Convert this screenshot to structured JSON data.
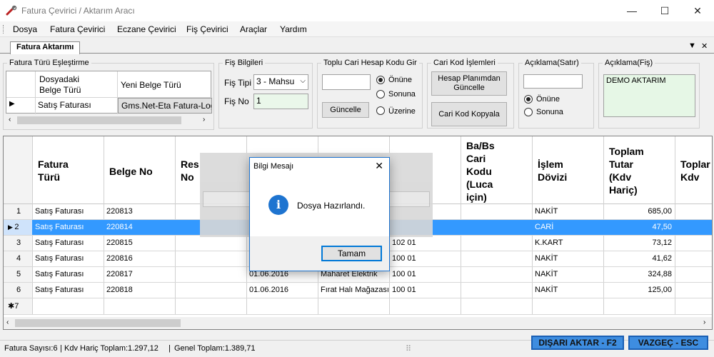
{
  "window": {
    "title": "Fatura Çevirici / Aktarım Aracı"
  },
  "menu": [
    "Dosya",
    "Fatura Çevirici",
    "Eczane Çevirici",
    "Fiş Çevirici",
    "Araçlar",
    "Yardım"
  ],
  "tab": {
    "label": "Fatura Aktarımı"
  },
  "mapping": {
    "title": "Fatura Türü Eşleştirme",
    "col1": "Dosyadaki\nBelge Türü",
    "col2": "Yeni Belge Türü",
    "row_source": "Satış Faturası",
    "row_target": "Gms.Net-Eta Fatura-Log"
  },
  "fis": {
    "title": "Fiş Bilgileri",
    "tip_label": "Fiş Tipi",
    "tip_value": "3 - Mahsu",
    "no_label": "Fiş No",
    "no_value": "1"
  },
  "toplu": {
    "title": "Toplu Cari Hesap Kodu Gir",
    "input_value": "",
    "button": "Güncelle",
    "options": [
      "Önüne",
      "Sonuna",
      "Üzerine"
    ],
    "selected": 0
  },
  "cari": {
    "title": "Cari Kod İşlemleri",
    "btn_update": "Hesap Planımdan\nGüncelle",
    "btn_copy": "Cari Kod Kopyala"
  },
  "aciklama_satir": {
    "title": "Açıklama(Satır)",
    "input_value": "",
    "options": [
      "Önüne",
      "Sonuna"
    ],
    "selected": 0
  },
  "aciklama_fis": {
    "title": "Açıklama(Fiş)",
    "value": "DEMO AKTARIM"
  },
  "grid": {
    "headers": [
      "Fatura\nTürü",
      "Belge No",
      "Res\nNo",
      "",
      "",
      "Ba/Bs\nCari\nKodu\n(Luca\niçin)",
      "İşlem\nDövizi",
      "Toplam\nTutar\n(Kdv\nHariç)",
      "Toplar\nKdv"
    ],
    "rows": [
      {
        "num": "1",
        "tur": "Satış Faturası",
        "belge": "220813",
        "tarih": "",
        "unvan": "",
        "kod": "",
        "doviz": "NAKİT",
        "tutar": "685,00"
      },
      {
        "num": "2",
        "tur": "Satış Faturası",
        "belge": "220814",
        "tarih": "",
        "unvan": "",
        "kod": "",
        "doviz": "CARİ",
        "tutar": "47,50"
      },
      {
        "num": "3",
        "tur": "Satış Faturası",
        "belge": "220815",
        "tarih": "",
        "unvan": "",
        "kod": "102 01",
        "doviz": "K.KART",
        "tutar": "73,12"
      },
      {
        "num": "4",
        "tur": "Satış Faturası",
        "belge": "220816",
        "tarih": "",
        "unvan": "",
        "kod": "100 01",
        "doviz": "NAKİT",
        "tutar": "41,62"
      },
      {
        "num": "5",
        "tur": "Satış Faturası",
        "belge": "220817",
        "tarih": "01.06.2016",
        "unvan": "Maharet Elektrik",
        "kod": "100 01",
        "doviz": "NAKİT",
        "tutar": "324,88"
      },
      {
        "num": "6",
        "tur": "Satış Faturası",
        "belge": "220818",
        "tarih": "01.06.2016",
        "unvan": "Fırat Halı Mağazası",
        "kod": "100 01",
        "doviz": "NAKİT",
        "tutar": "125,00"
      }
    ],
    "new_row_label": "7",
    "selected_row": 1
  },
  "status": {
    "count": "Fatura Sayısı:6",
    "kdv_haric": "Kdv Hariç Toplam:1.297,12",
    "genel": "Genel Toplam:1.389,71"
  },
  "actions": {
    "export": "DIŞARI AKTAR - F2",
    "cancel": "VAZGEÇ - ESC"
  },
  "dialog": {
    "title": "Bilgi Mesajı",
    "message": "Dosya Hazırlandı.",
    "ok": "Tamam"
  },
  "colors": {
    "selection": "#3399ff",
    "action_button": "#3e8de0",
    "info_icon": "#1e74d0",
    "aciklama_bg": "#e6f7e6"
  }
}
